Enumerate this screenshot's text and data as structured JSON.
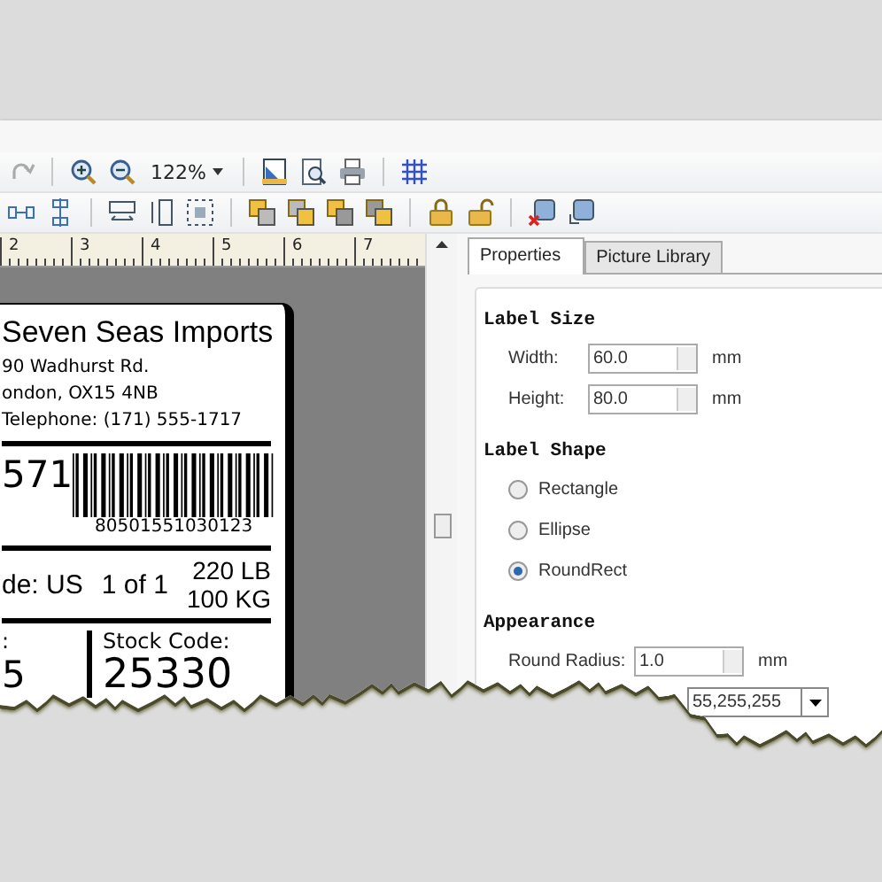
{
  "toolbar": {
    "zoom": "122%"
  },
  "ruler": {
    "marks": [
      "2",
      "3",
      "4",
      "5",
      "6",
      "7"
    ]
  },
  "label": {
    "company": "Seven Seas Imports",
    "address": [
      "90 Wadhurst Rd.",
      "ondon, OX15 4NB",
      "Telephone: (171) 555-1717"
    ],
    "order": "571",
    "barcode_number": "80501551030123",
    "country": "de: US",
    "count": "1 of 1",
    "weights": [
      "220 LB",
      "100 KG"
    ],
    "field_label": ":",
    "field_value": "5",
    "stock_label": "Stock Code:",
    "stock_value": "25330"
  },
  "tabs": [
    {
      "label": "Properties",
      "selected": true
    },
    {
      "label": "Picture Library",
      "selected": false
    }
  ],
  "sections": [
    {
      "title": "Label Size",
      "rows": [
        {
          "kind": "spin",
          "label": "Width:",
          "value": "60.0",
          "unit": "mm"
        },
        {
          "kind": "spin",
          "label": "Height:",
          "value": "80.0",
          "unit": "mm"
        }
      ]
    },
    {
      "title": "Label Shape",
      "rows": [
        {
          "kind": "radio",
          "label": "Rectangle",
          "selected": false
        },
        {
          "kind": "radio",
          "label": "Ellipse",
          "selected": false
        },
        {
          "kind": "radio",
          "label": "RoundRect",
          "selected": true
        }
      ]
    },
    {
      "title": "Appearance",
      "rows": [
        {
          "kind": "spin",
          "label": "Round Radius:",
          "value": "1.0",
          "unit": "mm"
        },
        {
          "kind": "color",
          "value": "55,255,255"
        }
      ]
    }
  ]
}
